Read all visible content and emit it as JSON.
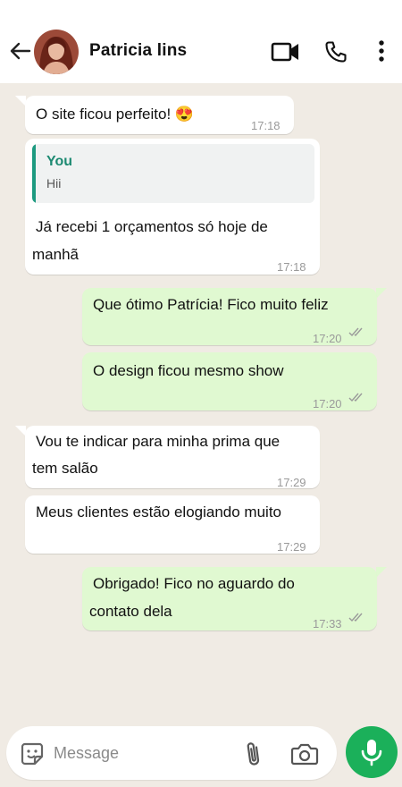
{
  "header": {
    "contact_name": "Patricia  lins"
  },
  "messages": [
    {
      "direction": "in",
      "text": "O site ficou perfeito! 😍",
      "time": "17:18"
    },
    {
      "direction": "in",
      "reply_to": {
        "author": "You",
        "text": "Hii"
      },
      "text": "Já recebi 1 orçamentos só hoje de manhã",
      "line1": "Já recebi 1 orçamentos só hoje de",
      "line2": "manhã",
      "time": "17:18"
    },
    {
      "direction": "out",
      "text": "Que ótimo Patrícia! Fico muito feliz",
      "time": "17:20",
      "status": "read"
    },
    {
      "direction": "out",
      "text": "O design ficou mesmo show",
      "time": "17:20",
      "status": "read"
    },
    {
      "direction": "in",
      "text": "Vou te indicar para minha prima que tem salão",
      "line1": "Vou te indicar para minha prima que",
      "line2": "tem salão",
      "time": "17:29"
    },
    {
      "direction": "in",
      "text": "Meus clientes estão elogiando muito",
      "time": "17:29"
    },
    {
      "direction": "out",
      "text": "Obrigado! Fico no aguardo do contato dela",
      "line1": "Obrigado! Fico no aguardo do",
      "line2": "contato dela",
      "time": "17:33",
      "status": "read"
    }
  ],
  "composer": {
    "placeholder": "Message"
  },
  "colors": {
    "incoming_bubble": "#ffffff",
    "outgoing_bubble": "#e0f9d1",
    "chat_background": "#f0ebe4",
    "accent_green": "#1bb05a",
    "reply_author": "#1d8a72"
  },
  "icons": [
    "back-arrow-icon",
    "video-call-icon",
    "phone-icon",
    "more-vertical-icon",
    "sticker-icon",
    "attach-icon",
    "camera-icon",
    "mic-icon",
    "read-ticks-icon"
  ]
}
